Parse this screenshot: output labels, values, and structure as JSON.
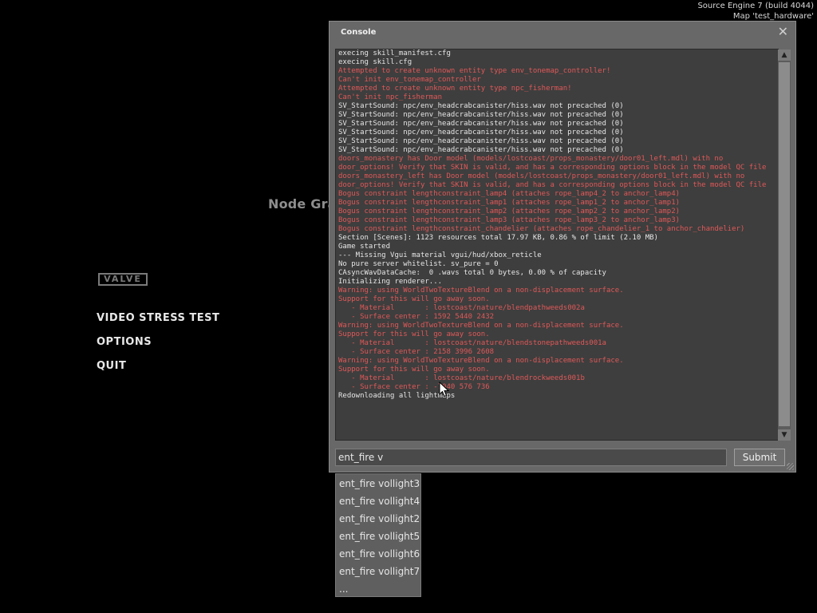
{
  "engine": {
    "build": "Source Engine 7 (build 4044)",
    "map": "Map 'test_hardware'"
  },
  "status_overlay": "Node Graph out of Date. Rebuilding...",
  "logo": "VALVE",
  "menu": [
    {
      "label": "VIDEO STRESS TEST"
    },
    {
      "label": "OPTIONS"
    },
    {
      "label": "QUIT"
    }
  ],
  "console": {
    "title": "Console",
    "close_icon": "close-icon",
    "log": [
      {
        "text": "execing skill_manifest.cfg",
        "color": "white"
      },
      {
        "text": "execing skill.cfg",
        "color": "white"
      },
      {
        "text": "Attempted to create unknown entity type env_tonemap_controller!",
        "color": "red"
      },
      {
        "text": "Can't init env_tonemap_controller",
        "color": "red"
      },
      {
        "text": "Attempted to create unknown entity type npc_fisherman!",
        "color": "red"
      },
      {
        "text": "Can't init npc_fisherman",
        "color": "red"
      },
      {
        "text": "SV_StartSound: npc/env_headcrabcanister/hiss.wav not precached (0)",
        "color": "white"
      },
      {
        "text": "SV_StartSound: npc/env_headcrabcanister/hiss.wav not precached (0)",
        "color": "white"
      },
      {
        "text": "SV_StartSound: npc/env_headcrabcanister/hiss.wav not precached (0)",
        "color": "white"
      },
      {
        "text": "SV_StartSound: npc/env_headcrabcanister/hiss.wav not precached (0)",
        "color": "white"
      },
      {
        "text": "SV_StartSound: npc/env_headcrabcanister/hiss.wav not precached (0)",
        "color": "white"
      },
      {
        "text": "SV_StartSound: npc/env_headcrabcanister/hiss.wav not precached (0)",
        "color": "white"
      },
      {
        "text": "doors_monastery has Door model (models/lostcoast/props_monastery/door01_left.mdl) with no door_options! Verify that SKIN is valid, and has a corresponding options block in the model QC file",
        "color": "red"
      },
      {
        "text": "doors_monastery_left has Door model (models/lostcoast/props_monastery/door01_left.mdl) with no door_options! Verify that SKIN is valid, and has a corresponding options block in the model QC file",
        "color": "red"
      },
      {
        "text": "Bogus constraint lengthconstraint_lamp4 (attaches rope_lamp4_2 to anchor_lamp4)",
        "color": "red"
      },
      {
        "text": "Bogus constraint lengthconstraint_lamp1 (attaches rope_lamp1_2 to anchor_lamp1)",
        "color": "red"
      },
      {
        "text": "Bogus constraint lengthconstraint_lamp2 (attaches rope_lamp2_2 to anchor_lamp2)",
        "color": "red"
      },
      {
        "text": "Bogus constraint lengthconstraint_lamp3 (attaches rope_lamp3_2 to anchor_lamp3)",
        "color": "red"
      },
      {
        "text": "Bogus constraint lengthconstraint_chandelier (attaches rope_chandelier_1 to anchor_chandelier)",
        "color": "red"
      },
      {
        "text": "Section [Scenes]: 1123 resources total 17.97 KB, 0.86 % of limit (2.10 MB)",
        "color": "white"
      },
      {
        "text": "Game started",
        "color": "white"
      },
      {
        "text": "--- Missing Vgui material vgui/hud/xbox_reticle",
        "color": "white"
      },
      {
        "text": "No pure server whitelist. sv_pure = 0",
        "color": "white"
      },
      {
        "text": "CAsyncWavDataCache:  0 .wavs total 0 bytes, 0.00 % of capacity",
        "color": "white"
      },
      {
        "text": "Initializing renderer...",
        "color": "white"
      },
      {
        "text": "Warning: using WorldTwoTextureBlend on a non-displacement surface.",
        "color": "red"
      },
      {
        "text": "Support for this will go away soon.",
        "color": "red"
      },
      {
        "text": "   - Material       : lostcoast/nature/blendpathweeds002a",
        "color": "red"
      },
      {
        "text": "   - Surface center : 1592 5440 2432",
        "color": "red"
      },
      {
        "text": "Warning: using WorldTwoTextureBlend on a non-displacement surface.",
        "color": "red"
      },
      {
        "text": "Support for this will go away soon.",
        "color": "red"
      },
      {
        "text": "   - Material       : lostcoast/nature/blendstonepathweeds001a",
        "color": "red"
      },
      {
        "text": "   - Surface center : 2158 3996 2608",
        "color": "red"
      },
      {
        "text": "Warning: using WorldTwoTextureBlend on a non-displacement surface.",
        "color": "red"
      },
      {
        "text": "Support for this will go away soon.",
        "color": "red"
      },
      {
        "text": "   - Material       : lostcoast/nature/blendrockweeds001b",
        "color": "red"
      },
      {
        "text": "   - Surface center : -7040 576 736",
        "color": "red"
      },
      {
        "text": "Redownloading all lightmaps",
        "color": "white"
      }
    ],
    "input_value": "ent_fire v",
    "submit_label": "Submit",
    "colors": {
      "log_white": "#e6e6e6",
      "log_red": "#e05858",
      "panel": "#686868"
    }
  },
  "autocomplete": [
    "ent_fire vollight3",
    "ent_fire vollight4",
    "ent_fire vollight2",
    "ent_fire vollight5",
    "ent_fire vollight6",
    "ent_fire vollight7",
    "..."
  ]
}
